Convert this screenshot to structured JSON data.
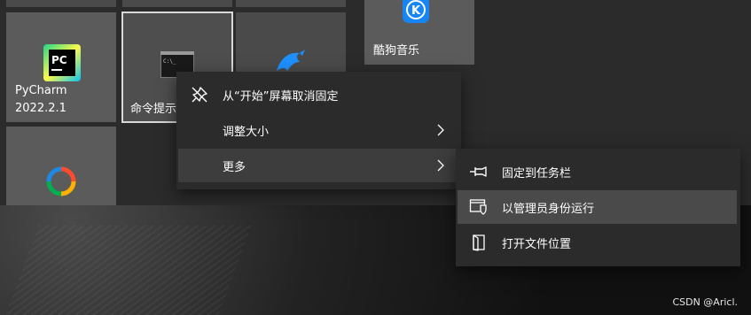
{
  "tiles": {
    "pycharm": {
      "name_line1": "PyCharm",
      "name_line2": "2022.2.1"
    },
    "cmd": {
      "name": "命令提示"
    },
    "kugou": {
      "name": "酷狗音乐"
    }
  },
  "context_menu": {
    "items": [
      {
        "label": "从“开始”屏幕取消固定",
        "icon": "unpin-icon"
      },
      {
        "label": "调整大小",
        "icon": "",
        "submenu": true
      },
      {
        "label": "更多",
        "icon": "",
        "submenu": true,
        "selected": true
      }
    ]
  },
  "submenu": {
    "items": [
      {
        "label": "固定到任务栏",
        "icon": "pin-icon"
      },
      {
        "label": "以管理员身份运行",
        "icon": "shield-window-icon",
        "highlighted": true
      },
      {
        "label": "打开文件位置",
        "icon": "open-folder-icon"
      }
    ]
  },
  "watermark": "CSDN @Aricl.",
  "colors": {
    "tile_bg": "#5b5b5b",
    "menu_bg": "#2b2b2b",
    "menu_selected": "#3d3d3d",
    "menu_highlight": "#4a4a4a",
    "pycharm_green": "#21d789",
    "kugou_blue": "#1686f7"
  }
}
